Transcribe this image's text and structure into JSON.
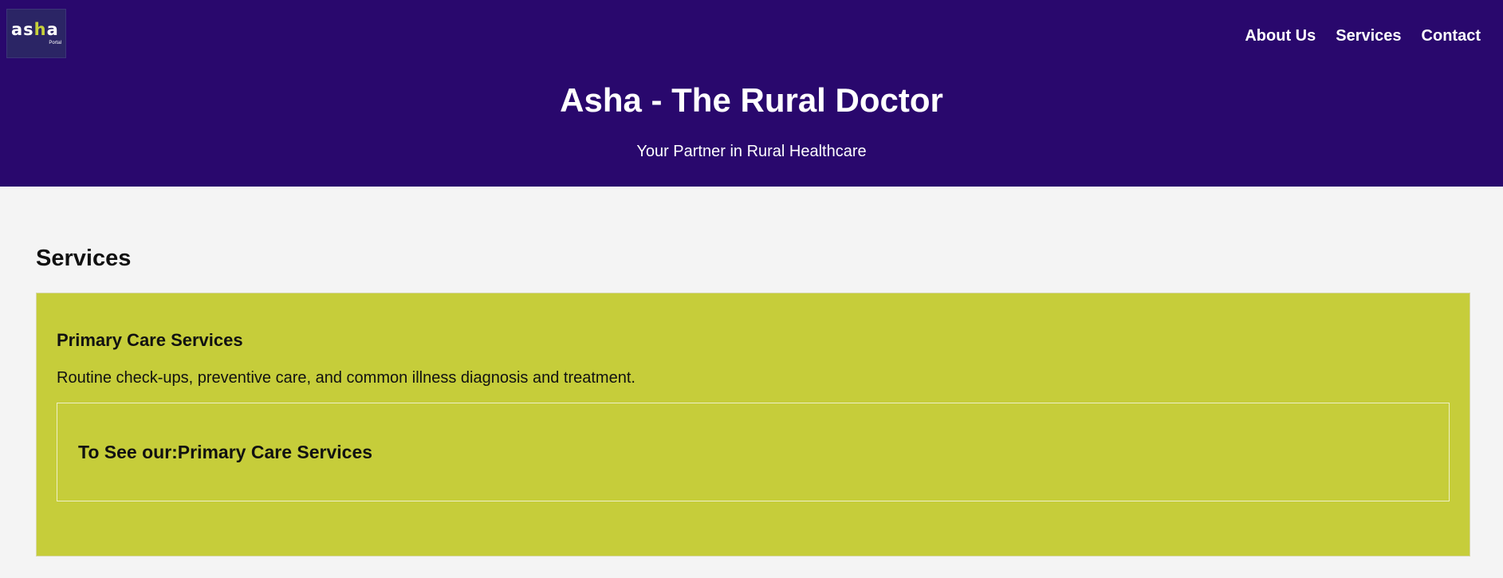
{
  "brand": {
    "logo_main_prefix": "as",
    "logo_main_accent": "h",
    "logo_main_suffix": "a",
    "logo_sub": "Portal"
  },
  "nav": {
    "items": [
      {
        "label": "About Us"
      },
      {
        "label": "Services"
      },
      {
        "label": "Contact"
      }
    ]
  },
  "hero": {
    "title": "Asha - The Rural Doctor",
    "subtitle": "Your Partner in Rural Healthcare"
  },
  "services": {
    "heading": "Services",
    "cards": [
      {
        "title": "Primary Care Services",
        "description": "Routine check-ups, preventive care, and common illness diagnosis and treatment.",
        "cta": "To See our:Primary Care Services"
      }
    ]
  },
  "colors": {
    "header_bg": "#29086d",
    "card_bg": "#c6cd3a",
    "page_bg": "#f4f4f4",
    "logo_accent": "#c7d03a"
  }
}
